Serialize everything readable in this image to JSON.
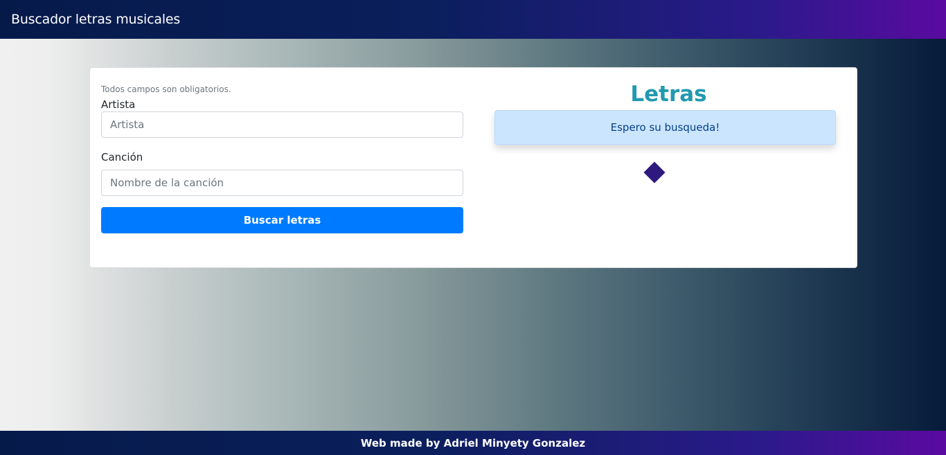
{
  "navbar": {
    "title": "Buscador letras musicales"
  },
  "form": {
    "hint": "Todos campos son obligatorios.",
    "artist_label": "Artista",
    "artist_placeholder": "Artista",
    "artist_value": "",
    "song_label": "Canción",
    "song_placeholder": "Nombre de la canción",
    "song_value": "",
    "submit_label": "Buscar letras"
  },
  "result": {
    "title": "Letras",
    "alert": "Espero su busqueda!"
  },
  "footer": {
    "text": "Web made by Adriel Minyety Gonzalez"
  },
  "colors": {
    "primary": "#007bff",
    "title": "#2299b0",
    "alert_bg": "#cce5ff",
    "spinner": "#2e1a7e"
  }
}
